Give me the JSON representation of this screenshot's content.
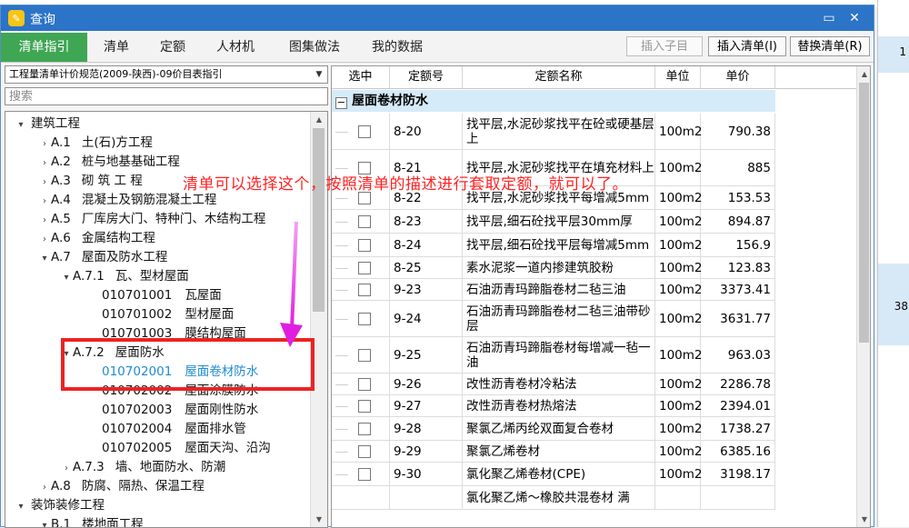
{
  "window": {
    "title": "查询",
    "minimize_glyph": "▭",
    "close_glyph": "✕"
  },
  "tabs": [
    "清单指引",
    "清单",
    "定额",
    "人材机",
    "图集做法",
    "我的数据"
  ],
  "toolbar": {
    "insert_child": "插入子目",
    "insert_list": "插入清单(I)",
    "replace_list": "替换清单(R)"
  },
  "left": {
    "combo_value": "工程量清单计价规范(2009-陕西)-09价目表指引",
    "search_placeholder": "搜索",
    "tree": [
      {
        "exp": "▾",
        "code": "",
        "label": "建筑工程"
      },
      {
        "exp": "›",
        "code": "A.1",
        "label": "土(石)方工程"
      },
      {
        "exp": "›",
        "code": "A.2",
        "label": "桩与地基基础工程"
      },
      {
        "exp": "›",
        "code": "A.3",
        "label": "砌 筑 工 程"
      },
      {
        "exp": "›",
        "code": "A.4",
        "label": "混凝土及钢筋混凝土工程"
      },
      {
        "exp": "›",
        "code": "A.5",
        "label": "厂库房大门、特种门、木结构工程"
      },
      {
        "exp": "›",
        "code": "A.6",
        "label": "金属结构工程"
      },
      {
        "exp": "▾",
        "code": "A.7",
        "label": "屋面及防水工程"
      },
      {
        "exp": "▾",
        "code": "A.7.1",
        "label": "瓦、型材屋面"
      },
      {
        "exp": "",
        "code": "010701001",
        "label": "瓦屋面"
      },
      {
        "exp": "",
        "code": "010701002",
        "label": "型材屋面"
      },
      {
        "exp": "",
        "code": "010701003",
        "label": "膜结构屋面"
      },
      {
        "exp": "▾",
        "code": "A.7.2",
        "label": "屋面防水"
      },
      {
        "exp": "",
        "code": "010702001",
        "label": "屋面卷材防水"
      },
      {
        "exp": "",
        "code": "010702002",
        "label": "屋面涂膜防水"
      },
      {
        "exp": "",
        "code": "010702003",
        "label": "屋面刚性防水"
      },
      {
        "exp": "",
        "code": "010702004",
        "label": "屋面排水管"
      },
      {
        "exp": "",
        "code": "010702005",
        "label": "屋面天沟、沿沟"
      },
      {
        "exp": "›",
        "code": "A.7.3",
        "label": "墙、地面防水、防潮"
      },
      {
        "exp": "›",
        "code": "A.8",
        "label": "防腐、隔热、保温工程"
      },
      {
        "exp": "▾",
        "code": "",
        "label": "装饰装修工程"
      },
      {
        "exp": "▾",
        "code": "B.1",
        "label": "楼地面工程"
      }
    ]
  },
  "table": {
    "headers": [
      "选中",
      "定额号",
      "定额名称",
      "单位",
      "单价"
    ],
    "group": "屋面卷材防水",
    "rows": [
      {
        "code": "8-20",
        "name": "找平层,水泥砂浆找平在砼或硬基层上",
        "unit": "100m2",
        "price": "790.38"
      },
      {
        "code": "8-21",
        "name": "找平层,水泥砂浆找平在填充材料上",
        "unit": "100m2",
        "price": "885"
      },
      {
        "code": "8-22",
        "name": "找平层,水泥砂浆找平每增减5mm",
        "unit": "100m2",
        "price": "153.53"
      },
      {
        "code": "8-23",
        "name": "找平层,细石砼找平层30mm厚",
        "unit": "100m2",
        "price": "894.87"
      },
      {
        "code": "8-24",
        "name": "找平层,细石砼找平层每增减5mm",
        "unit": "100m2",
        "price": "156.9"
      },
      {
        "code": "8-25",
        "name": "素水泥浆一道内掺建筑胶粉",
        "unit": "100m2",
        "price": "123.83"
      },
      {
        "code": "9-23",
        "name": "石油沥青玛蹄脂卷材二毡三油",
        "unit": "100m2",
        "price": "3373.41"
      },
      {
        "code": "9-24",
        "name": "石油沥青玛蹄脂卷材二毡三油带砂层",
        "unit": "100m2",
        "price": "3631.77"
      },
      {
        "code": "9-25",
        "name": "石油沥青玛蹄脂卷材每增减一毡一油",
        "unit": "100m2",
        "price": "963.03"
      },
      {
        "code": "9-26",
        "name": "改性沥青卷材冷粘法",
        "unit": "100m2",
        "price": "2286.78"
      },
      {
        "code": "9-27",
        "name": "改性沥青卷材热熔法",
        "unit": "100m2",
        "price": "2394.01"
      },
      {
        "code": "9-28",
        "name": "聚氯乙烯丙纶双面复合卷材",
        "unit": "100m2",
        "price": "1738.27"
      },
      {
        "code": "9-29",
        "name": "聚氯乙烯卷材",
        "unit": "100m2",
        "price": "6385.16"
      },
      {
        "code": "9-30",
        "name": "氯化聚乙烯卷材(CPE)",
        "unit": "100m2",
        "price": "3198.17"
      },
      {
        "code": "",
        "name": "氯化聚乙烯～橡胶共混卷材 满",
        "unit": "",
        "price": ""
      }
    ]
  },
  "annotation": "清单可以选择这个，按照清单的描述进行套取定额，就可以了。",
  "background": {
    "right_num_1": "1",
    "right_num_2": "38"
  },
  "colors": {
    "titlebar": "#2b74c7",
    "active_tab": "#3fa654",
    "annotation": "#ff2222",
    "selected_item": "#1f8bd0",
    "group_row": "#d6ebf9"
  }
}
